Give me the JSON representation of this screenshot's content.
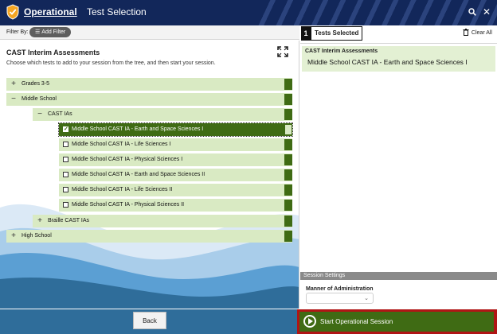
{
  "header": {
    "brand": "Operational",
    "title": "Test Selection",
    "search_icon": "search-icon",
    "close_icon": "close-icon"
  },
  "filter": {
    "label": "Filter By:",
    "add_filter": "Add Filter"
  },
  "left_panel": {
    "title": "CAST Interim Assessments",
    "description": "Choose which tests to add to your session from the tree, and then start your session."
  },
  "tree": [
    {
      "label": "Grades 3-5",
      "toggle": "+"
    },
    {
      "label": "Middle School",
      "toggle": "−"
    },
    {
      "label": "CAST IAs",
      "toggle": "−"
    },
    {
      "label": "Middle School CAST IA - Earth and Space Sciences I",
      "selected": true
    },
    {
      "label": "Middle School CAST IA - Life Sciences I",
      "selected": false
    },
    {
      "label": "Middle School CAST IA - Physical Sciences I",
      "selected": false
    },
    {
      "label": "Middle School CAST IA - Earth and Space Sciences II",
      "selected": false
    },
    {
      "label": "Middle School CAST IA - Life Sciences II",
      "selected": false
    },
    {
      "label": "Middle School CAST IA - Physical Sciences II",
      "selected": false
    },
    {
      "label": "Braille CAST IAs",
      "toggle": "+"
    },
    {
      "label": "High School",
      "toggle": "+"
    }
  ],
  "footer": {
    "back": "Back",
    "start": "Start Operational Session"
  },
  "selected_panel": {
    "count": "1",
    "title": "Tests Selected",
    "clear_all": "Clear All",
    "group_title": "CAST Interim Assessments",
    "items": [
      "Middle School CAST IA - Earth and Space Sciences I"
    ]
  },
  "session_settings": {
    "title": "Session Settings",
    "manner_label": "Manner of Administration",
    "manner_value": ""
  },
  "colors": {
    "header": "#12275a",
    "tree_row": "#d9eac3",
    "accent_green": "#3f6b14",
    "highlight_red": "#b01515"
  }
}
